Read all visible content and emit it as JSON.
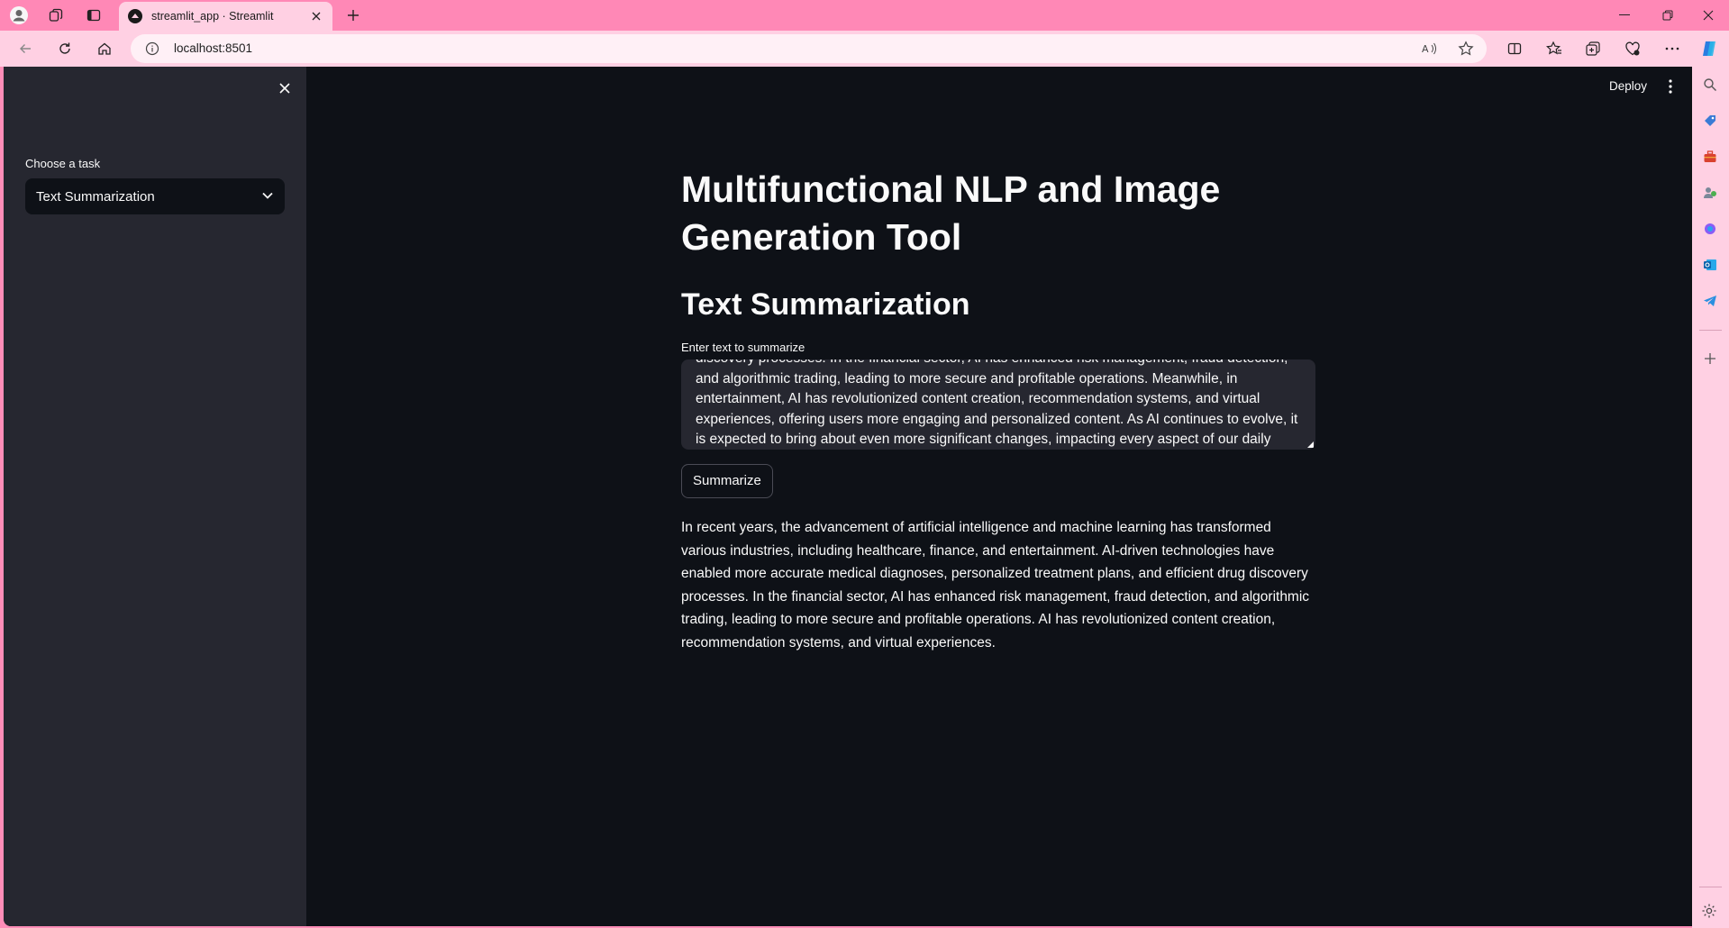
{
  "browser": {
    "tab_title": "streamlit_app · Streamlit",
    "url": "localhost:8501"
  },
  "sidebar": {
    "select_label": "Choose a task",
    "select_value": "Text Summarization"
  },
  "header": {
    "deploy_label": "Deploy"
  },
  "main": {
    "title": "Multifunctional NLP and Image Generation Tool",
    "subtitle": "Text Summarization",
    "textarea_label": "Enter text to summarize",
    "textarea_value": "discovery processes. In the financial sector, AI has enhanced risk management, fraud detection, and algorithmic trading, leading to more secure and profitable operations. Meanwhile, in entertainment, AI has revolutionized content creation, recommendation systems, and virtual experiences, offering users more engaging and personalized content. As AI continues to evolve, it is expected to bring about even more significant changes, impacting every aspect of our daily lives.",
    "button_label": "Summarize",
    "summary": "In recent years, the advancement of artificial intelligence and machine learning has transformed various industries, including healthcare, finance, and entertainment. AI-driven technologies have enabled more accurate medical diagnoses, personalized treatment plans, and efficient drug discovery processes. In the financial sector, AI has enhanced risk management, fraud detection, and algorithmic trading, leading to more secure and profitable operations. AI has revolutionized content creation, recommendation systems, and virtual experiences."
  },
  "colors": {
    "browser_frame": "#ff88b6",
    "toolbar": "#ffd0e3",
    "app_background": "#0e1117",
    "sidebar_background": "#262730",
    "text": "#fafafa"
  },
  "icons": [
    "profile-icon",
    "workspaces-icon",
    "tab-actions-icon",
    "streamlit-favicon",
    "close-icon",
    "new-tab-icon",
    "minimize-icon",
    "restore-icon",
    "window-close-icon",
    "back-icon",
    "refresh-icon",
    "home-icon",
    "info-icon",
    "read-aloud-icon",
    "favorite-star-icon",
    "split-screen-icon",
    "favorites-icon",
    "collections-icon",
    "browser-essentials-icon",
    "more-icon",
    "copilot-icon",
    "search-icon",
    "shopping-icon",
    "tools-icon",
    "games-icon",
    "m365-icon",
    "outlook-icon",
    "telegram-icon",
    "add-icon",
    "settings-icon",
    "chevron-down-icon",
    "kebab-menu-icon"
  ]
}
